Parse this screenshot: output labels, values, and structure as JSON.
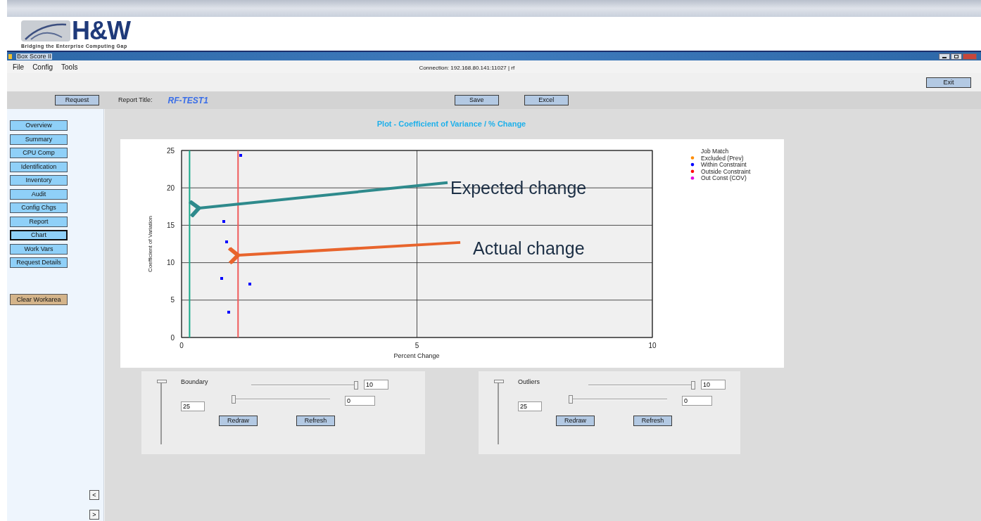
{
  "logo": {
    "text": "H&W",
    "tagline": "Bridging the Enterprise Computing Gap"
  },
  "window": {
    "title": "Box Score II"
  },
  "menu": [
    "File",
    "Config",
    "Tools"
  ],
  "connection": "Connection: 192.168.80.141:11027 | rf",
  "exit_button": "Exit",
  "toolbar": {
    "request_button": "Request",
    "report_title_label": "Report Title:",
    "report_title": "RF-TEST1",
    "save_button": "Save",
    "excel_button": "Excel"
  },
  "sidebar": {
    "items": [
      {
        "label": "Overview",
        "selected": false
      },
      {
        "label": "Summary",
        "selected": false
      },
      {
        "label": "CPU Comp",
        "selected": false
      },
      {
        "label": "Identification",
        "selected": false
      },
      {
        "label": "Inventory",
        "selected": false
      },
      {
        "label": "Audit",
        "selected": false
      },
      {
        "label": "Config Chgs",
        "selected": false
      },
      {
        "label": "Report",
        "selected": false
      },
      {
        "label": "Chart",
        "selected": true
      },
      {
        "label": "Work Vars",
        "selected": false
      },
      {
        "label": "Request Details",
        "selected": false
      }
    ],
    "clear_button": "Clear Workarea",
    "prev_button": "<",
    "next_button": ">"
  },
  "chart": {
    "title": "Plot - Coefficient of Variance / % Change",
    "chart_data": {
      "type": "scatter",
      "xlabel": "Percent Change",
      "ylabel": "Coefficient of Variation",
      "xlim": [
        0,
        10
      ],
      "ylim": [
        0,
        25
      ],
      "xticks": [
        0,
        5,
        10
      ],
      "yticks": [
        0,
        5,
        10,
        15,
        20,
        25
      ],
      "grid": true,
      "x": [
        1.25,
        0.9,
        0.95,
        0.85,
        1.45,
        1.0
      ],
      "series": [
        {
          "name": "Within Constraint",
          "color": "#0000ff",
          "values": [
            24.3,
            15.5,
            12.8,
            7.9,
            7.1,
            3.4
          ]
        }
      ],
      "ref_lines": [
        {
          "axis": "x",
          "value": 0.17,
          "color": "#1aaa8a"
        },
        {
          "axis": "x",
          "value": 1.2,
          "color": "#f05a5a"
        }
      ]
    },
    "callouts": [
      {
        "text": "Expected change",
        "color": "#2e8a8c"
      },
      {
        "text": "Actual change",
        "color": "#e8642c"
      }
    ],
    "legend": {
      "title": "Job Match",
      "items": [
        {
          "label": "Excluded (Prev)",
          "color": "#ff8c00"
        },
        {
          "kind": "series"
        },
        {
          "label": "Outside Constraint",
          "color": "#ff0000"
        },
        {
          "label": "Out Const (COV)",
          "color": "#e000e0"
        }
      ]
    }
  },
  "panels": [
    {
      "title": "Boundary",
      "vertical_slider": {
        "level": 1
      },
      "vertical_value": "25",
      "sliders": [
        {
          "level": 1,
          "value": "10"
        },
        {
          "level": 0,
          "value": "0"
        }
      ],
      "buttons": [
        "Redraw",
        "Refresh"
      ]
    },
    {
      "title": "Outliers",
      "vertical_slider": {
        "level": 1
      },
      "vertical_value": "25",
      "sliders": [
        {
          "level": 1,
          "value": "10"
        },
        {
          "level": 0,
          "value": "0"
        }
      ],
      "buttons": [
        "Redraw",
        "Refresh"
      ]
    }
  ]
}
